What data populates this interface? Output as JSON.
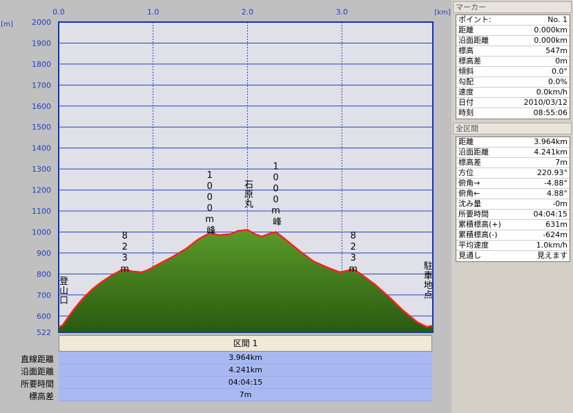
{
  "chart_data": {
    "type": "area",
    "x_unit": "[km]",
    "y_unit": "[m]",
    "x_ticks": [
      "0.0",
      "1.0",
      "2.0",
      "3.0"
    ],
    "y_ticks": [
      "2000",
      "1900",
      "1800",
      "1700",
      "1600",
      "1500",
      "1400",
      "1300",
      "1200",
      "1100",
      "1000",
      "900",
      "800",
      "700",
      "600",
      "522"
    ],
    "ylim": [
      522,
      2000
    ],
    "xlim": [
      0,
      3.964
    ],
    "profile": [
      [
        0.0,
        547
      ],
      [
        0.04,
        555
      ],
      [
        0.08,
        580
      ],
      [
        0.15,
        625
      ],
      [
        0.25,
        680
      ],
      [
        0.35,
        725
      ],
      [
        0.45,
        760
      ],
      [
        0.55,
        790
      ],
      [
        0.65,
        815
      ],
      [
        0.7,
        823
      ],
      [
        0.78,
        812
      ],
      [
        0.88,
        808
      ],
      [
        0.95,
        820
      ],
      [
        1.05,
        845
      ],
      [
        1.2,
        880
      ],
      [
        1.35,
        920
      ],
      [
        1.48,
        965
      ],
      [
        1.6,
        995
      ],
      [
        1.7,
        985
      ],
      [
        1.82,
        990
      ],
      [
        1.9,
        1005
      ],
      [
        2.0,
        1010
      ],
      [
        2.08,
        990
      ],
      [
        2.15,
        978
      ],
      [
        2.22,
        990
      ],
      [
        2.3,
        1000
      ],
      [
        2.4,
        965
      ],
      [
        2.55,
        910
      ],
      [
        2.7,
        860
      ],
      [
        2.85,
        830
      ],
      [
        2.98,
        808
      ],
      [
        3.05,
        815
      ],
      [
        3.12,
        823
      ],
      [
        3.2,
        800
      ],
      [
        3.35,
        750
      ],
      [
        3.5,
        690
      ],
      [
        3.65,
        625
      ],
      [
        3.8,
        570
      ],
      [
        3.9,
        548
      ],
      [
        3.964,
        554
      ]
    ],
    "annotations": [
      {
        "text": "登山口",
        "x": 0.04,
        "y": 720,
        "vertical": true
      },
      {
        "text": "823m",
        "x": 0.7,
        "y": 900,
        "vertical": true
      },
      {
        "text": "1000m峰",
        "x": 1.6,
        "y": 1140,
        "vertical": true
      },
      {
        "text": "石原丸",
        "x": 2.0,
        "y": 1180,
        "vertical": true
      },
      {
        "text": "1000m峰",
        "x": 2.3,
        "y": 1180,
        "vertical": true
      },
      {
        "text": "823m",
        "x": 3.12,
        "y": 900,
        "vertical": true
      },
      {
        "text": "駐車地点",
        "x": 3.9,
        "y": 770,
        "vertical": true
      }
    ]
  },
  "section": {
    "header": "区間 1",
    "rows": [
      {
        "label": "直線距離",
        "value": "3.964km"
      },
      {
        "label": "沿面距離",
        "value": "4.241km"
      },
      {
        "label": "所要時間",
        "value": "04:04:15"
      },
      {
        "label": "標高差",
        "value": "7m"
      }
    ]
  },
  "marker_panel": {
    "title": "マーカー",
    "rows": [
      {
        "label": "ポイント:",
        "value": "No. 1"
      },
      {
        "label": "距離",
        "value": "0.000km"
      },
      {
        "label": "沿面距離",
        "value": "0.000km"
      },
      {
        "label": "標高",
        "value": "547m"
      },
      {
        "label": "標高差",
        "value": "0m"
      },
      {
        "label": "傾斜",
        "value": "0.0°"
      },
      {
        "label": "勾配",
        "value": "0.0%"
      },
      {
        "label": "速度",
        "value": "0.0km/h"
      },
      {
        "label": "日付",
        "value": "2010/03/12"
      },
      {
        "label": "時刻",
        "value": "08:55:06"
      }
    ]
  },
  "total_panel": {
    "title": "全区間",
    "rows": [
      {
        "label": "距離",
        "value": "3.964km"
      },
      {
        "label": "沿面距離",
        "value": "4.241km"
      },
      {
        "label": "標高差",
        "value": "7m"
      },
      {
        "label": "方位",
        "value": "220.93°"
      },
      {
        "label": "俯角→",
        "value": "-4.88°"
      },
      {
        "label": "俯角←",
        "value": "4.88°"
      },
      {
        "label": "沈み量",
        "value": "-0m"
      },
      {
        "label": "所要時間",
        "value": "04:04:15"
      },
      {
        "label": "累積標高(+)",
        "value": "631m"
      },
      {
        "label": "累積標高(-)",
        "value": "-624m"
      },
      {
        "label": "平均速度",
        "value": "1.0km/h"
      },
      {
        "label": "見通し",
        "value": "見えます"
      }
    ]
  },
  "colors": {
    "plot_bg": "#e0e0e8",
    "fill_top": "#5a9a2a",
    "fill_bottom": "#2a5a10",
    "line": "#ff2020",
    "grid": "#2040c0",
    "tick_text": "#2040c0"
  }
}
